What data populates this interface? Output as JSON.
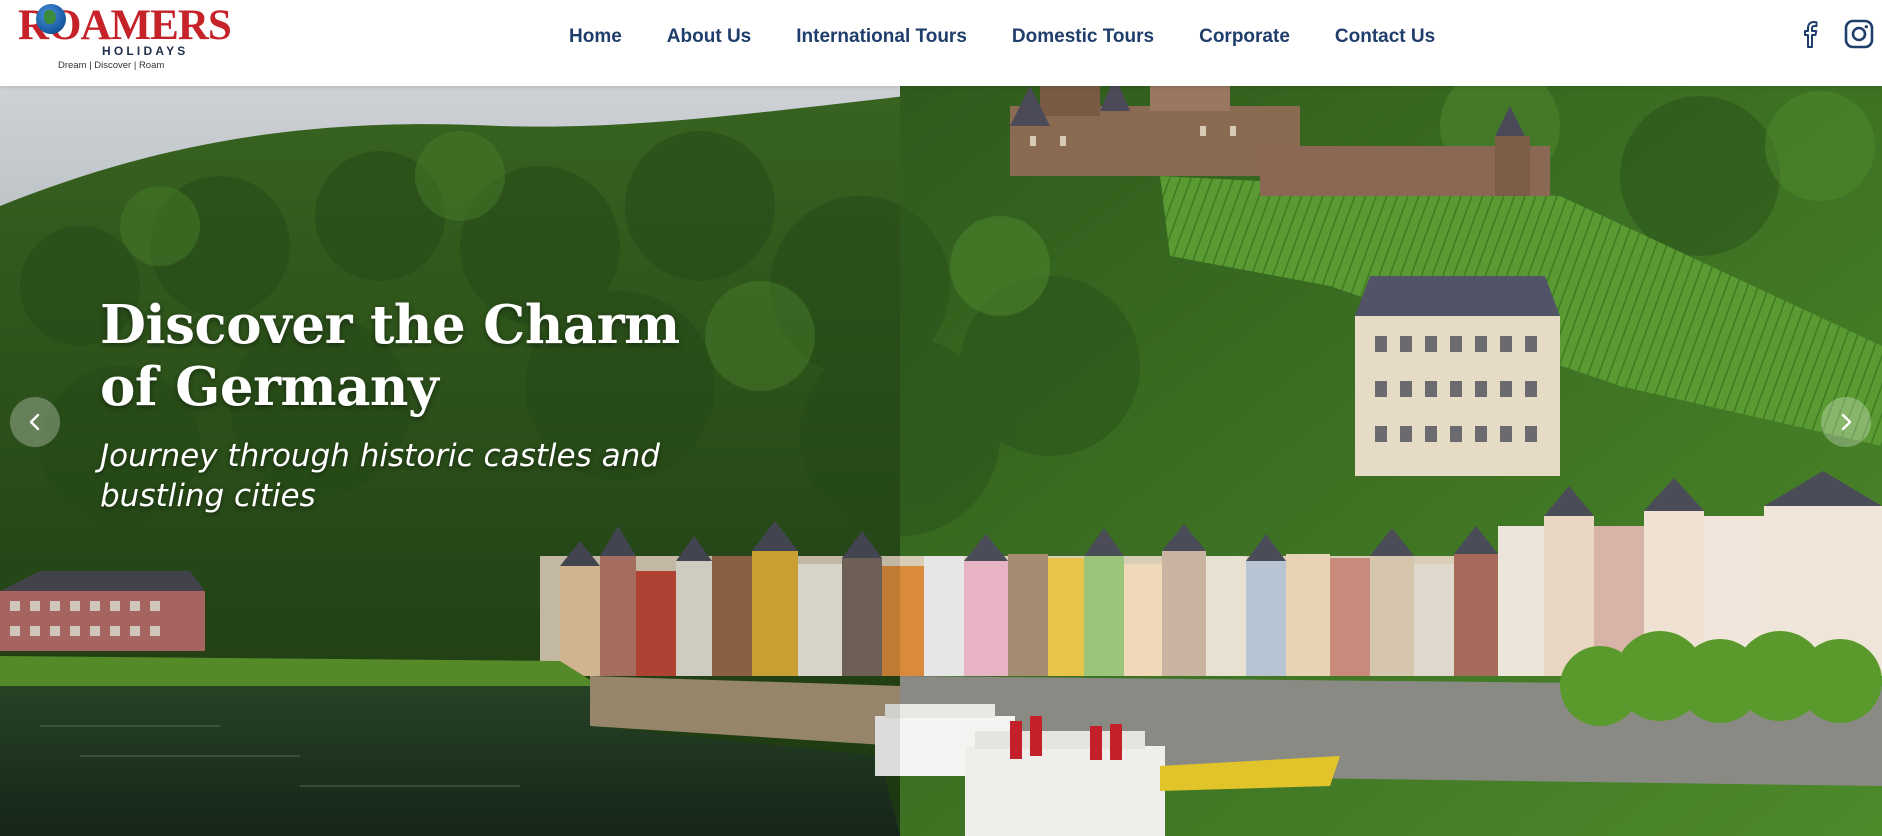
{
  "brand": {
    "name": "ROAMERS",
    "sub": "HOLIDAYS",
    "tagline": "Dream | Discover | Roam",
    "colors": {
      "primary_red": "#c62229",
      "navy": "#1f3e6b"
    }
  },
  "nav": {
    "items": [
      {
        "label": "Home"
      },
      {
        "label": "About Us"
      },
      {
        "label": "International Tours"
      },
      {
        "label": "Domestic Tours"
      },
      {
        "label": "Corporate"
      },
      {
        "label": "Contact Us"
      }
    ]
  },
  "social": {
    "icons": [
      "facebook-icon",
      "instagram-icon"
    ]
  },
  "hero": {
    "title": "Discover the Charm of Germany",
    "subtitle": "Journey through historic castles and bustling cities",
    "prev_icon": "chevron-left-icon",
    "next_icon": "chevron-right-icon"
  }
}
